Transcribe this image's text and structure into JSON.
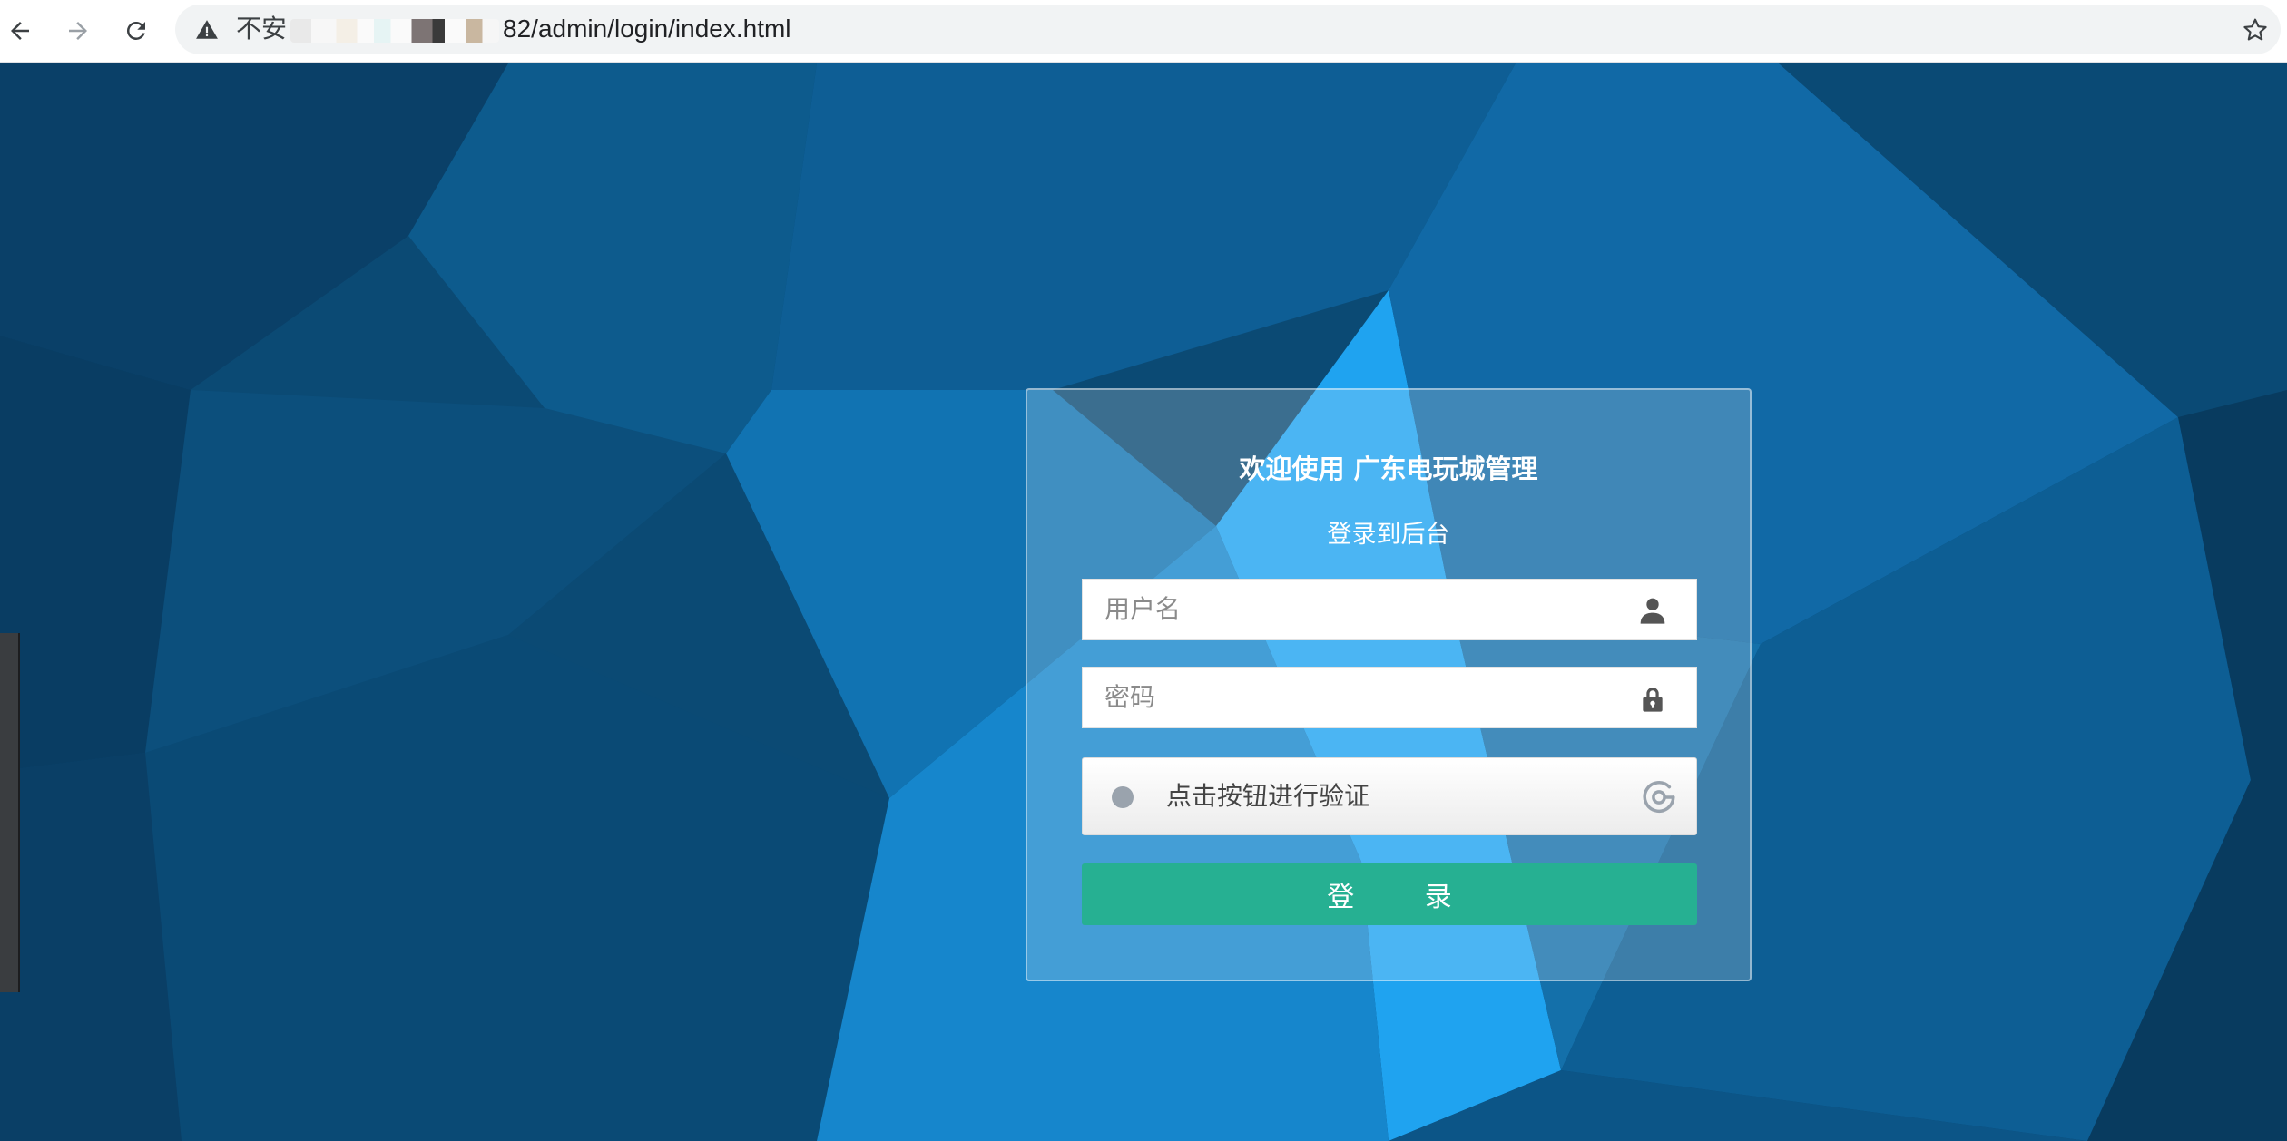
{
  "browser": {
    "url_security_label": "不安",
    "url_path": "82/admin/login/index.html",
    "warning_icon": "warning-triangle-icon",
    "star_icon": "bookmark-star-icon"
  },
  "login": {
    "title": "欢迎使用 广东电玩城管理",
    "subtitle": "登录到后台",
    "username_placeholder": "用户名",
    "password_placeholder": "密码",
    "verify_label": "点击按钮进行验证",
    "submit_label": "登 录",
    "username_icon": "user-icon",
    "password_icon": "lock-icon",
    "verify_icon": "captcha-refresh-icon"
  },
  "colors": {
    "background": "#0b4a74",
    "accent_light": "#1fa3f0",
    "login_button": "#26b092"
  }
}
